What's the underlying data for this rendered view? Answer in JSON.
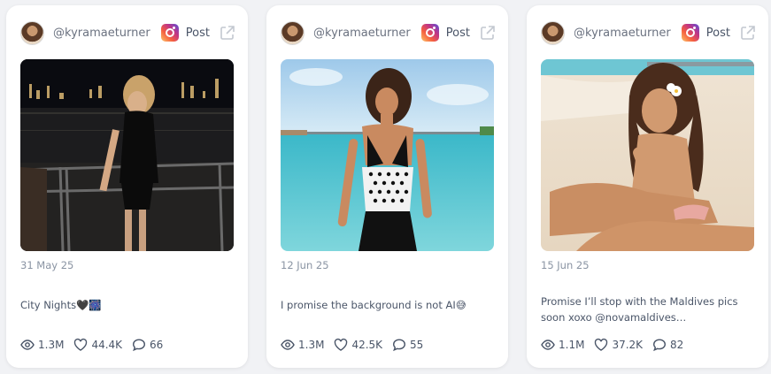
{
  "posts": [
    {
      "username": "@kyramaeturner",
      "platform_icon": "instagram-icon",
      "post_label": "Post",
      "date": "31 May 25",
      "caption": "City Nights🖤🎆",
      "views": "1.3M",
      "likes": "44.4K",
      "comments": "66"
    },
    {
      "username": "@kyramaeturner",
      "platform_icon": "instagram-icon",
      "post_label": "Post",
      "date": "12 Jun 25",
      "caption": "I promise the background is not AI😅",
      "views": "1.3M",
      "likes": "42.5K",
      "comments": "55"
    },
    {
      "username": "@kyramaeturner",
      "platform_icon": "instagram-icon",
      "post_label": "Post",
      "date": "15 Jun 25",
      "caption": "Promise I’ll stop with the Maldives pics soon xoxo @novamaldives…",
      "views": "1.1M",
      "likes": "37.2K",
      "comments": "82"
    }
  ],
  "colors": {
    "card_bg": "#ffffff",
    "page_bg": "#f1f2f5",
    "text_muted": "#8a94a3",
    "text_main": "#4a5568"
  }
}
